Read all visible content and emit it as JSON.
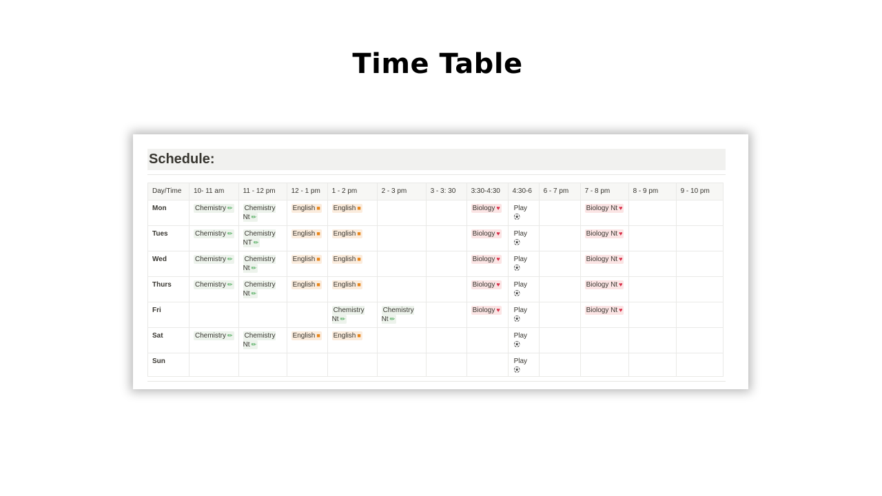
{
  "page_title": "Time Table",
  "schedule": {
    "heading": "Schedule:",
    "columns": [
      "Day/Time",
      "10- 11 am",
      "11 - 12 pm",
      "12 - 1 pm",
      "1 - 2 pm",
      "2 - 3 pm",
      "3 - 3: 30",
      "3:30-4:30",
      "4:30-6",
      "6 - 7 pm",
      "7 - 8 pm",
      "8 - 9 pm",
      "9 - 10 pm"
    ],
    "colors": {
      "chemistry_bg": "#edf3ec",
      "english_bg": "#fbecdd",
      "biology_bg": "#fbe4e4",
      "play_bg": "#ffffff",
      "pencil_icon": "#2e9b3f",
      "book_icon": "#e8851a",
      "heart_icon": "#d9304a",
      "ball_icon": "#444444"
    },
    "icons": {
      "pencil": "pencil-icon",
      "book": "book-icon",
      "heart": "anatomical-heart-icon",
      "ball": "soccer-ball-icon"
    },
    "rows": [
      {
        "day": "Mon",
        "cells": [
          {
            "text": "Chemistry",
            "icon": "pencil",
            "kind": "chemistry"
          },
          {
            "text": "Chemistry Nt",
            "icon": "pencil",
            "kind": "chemistry"
          },
          {
            "text": "English",
            "icon": "book",
            "kind": "english"
          },
          {
            "text": "English",
            "icon": "book",
            "kind": "english"
          },
          null,
          null,
          {
            "text": "Biology",
            "icon": "heart",
            "kind": "biology"
          },
          {
            "text": "Play",
            "icon": "ball",
            "kind": "play"
          },
          null,
          {
            "text": "Biology Nt",
            "icon": "heart",
            "kind": "biology"
          },
          null,
          null
        ]
      },
      {
        "day": "Tues",
        "cells": [
          {
            "text": "Chemistry",
            "icon": "pencil",
            "kind": "chemistry"
          },
          {
            "text": "Chemistry NT",
            "icon": "pencil",
            "kind": "chemistry"
          },
          {
            "text": "English",
            "icon": "book",
            "kind": "english"
          },
          {
            "text": "English",
            "icon": "book",
            "kind": "english"
          },
          null,
          null,
          {
            "text": "Biology",
            "icon": "heart",
            "kind": "biology"
          },
          {
            "text": "Play",
            "icon": "ball",
            "kind": "play"
          },
          null,
          {
            "text": "Biology Nt",
            "icon": "heart",
            "kind": "biology"
          },
          null,
          null
        ]
      },
      {
        "day": "Wed",
        "cells": [
          {
            "text": "Chemistry",
            "icon": "pencil",
            "kind": "chemistry"
          },
          {
            "text": "Chemistry Nt",
            "icon": "pencil",
            "kind": "chemistry"
          },
          {
            "text": "English",
            "icon": "book",
            "kind": "english"
          },
          {
            "text": "English",
            "icon": "book",
            "kind": "english"
          },
          null,
          null,
          {
            "text": "Biology",
            "icon": "heart",
            "kind": "biology"
          },
          {
            "text": "Play",
            "icon": "ball",
            "kind": "play"
          },
          null,
          {
            "text": "Biology Nt",
            "icon": "heart",
            "kind": "biology"
          },
          null,
          null
        ]
      },
      {
        "day": "Thurs",
        "cells": [
          {
            "text": "Chemistry",
            "icon": "pencil",
            "kind": "chemistry"
          },
          {
            "text": "Chemistry Nt",
            "icon": "pencil",
            "kind": "chemistry"
          },
          {
            "text": "English",
            "icon": "book",
            "kind": "english"
          },
          {
            "text": "English",
            "icon": "book",
            "kind": "english"
          },
          null,
          null,
          {
            "text": "Biology",
            "icon": "heart",
            "kind": "biology"
          },
          {
            "text": "Play",
            "icon": "ball",
            "kind": "play"
          },
          null,
          {
            "text": "Biology Nt",
            "icon": "heart",
            "kind": "biology"
          },
          null,
          null
        ]
      },
      {
        "day": "Fri",
        "cells": [
          null,
          null,
          null,
          {
            "text": "Chemistry Nt",
            "icon": "pencil",
            "kind": "chemistry"
          },
          {
            "text": "Chemistry Nt",
            "icon": "pencil",
            "kind": "chemistry"
          },
          null,
          {
            "text": "Biology",
            "icon": "heart",
            "kind": "biology"
          },
          {
            "text": "Play",
            "icon": "ball",
            "kind": "play"
          },
          null,
          {
            "text": "Biology Nt",
            "icon": "heart",
            "kind": "biology"
          },
          null,
          null
        ]
      },
      {
        "day": "Sat",
        "cells": [
          {
            "text": "Chemistry",
            "icon": "pencil",
            "kind": "chemistry"
          },
          {
            "text": "Chemistry Nt",
            "icon": "pencil",
            "kind": "chemistry"
          },
          {
            "text": "English",
            "icon": "book",
            "kind": "english"
          },
          {
            "text": "English",
            "icon": "book",
            "kind": "english"
          },
          null,
          null,
          null,
          {
            "text": "Play",
            "icon": "ball",
            "kind": "play"
          },
          null,
          null,
          null,
          null
        ]
      },
      {
        "day": "Sun",
        "cells": [
          null,
          null,
          null,
          null,
          null,
          null,
          null,
          {
            "text": "Play",
            "icon": "ball",
            "kind": "play"
          },
          null,
          null,
          null,
          null
        ]
      }
    ]
  }
}
